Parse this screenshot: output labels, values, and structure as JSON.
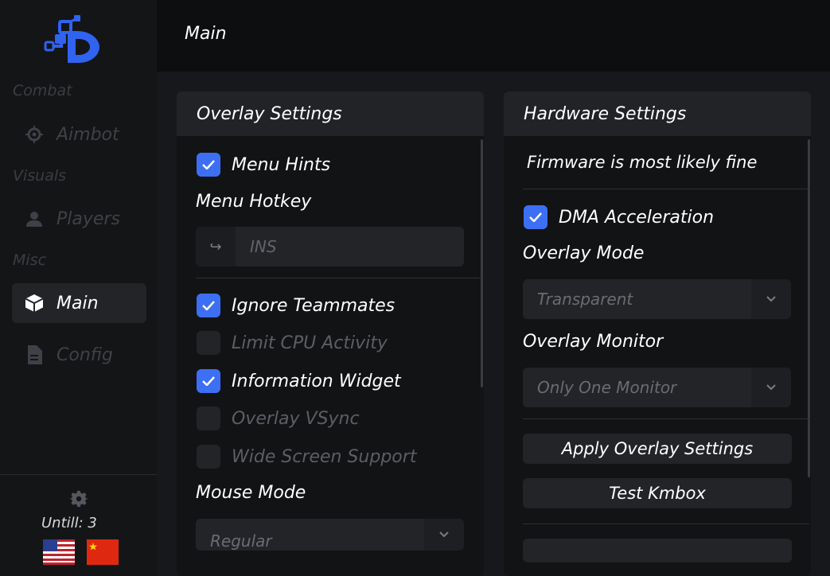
{
  "header": {
    "title": "Main"
  },
  "sidebar": {
    "sections": [
      {
        "label": "Combat",
        "items": [
          {
            "label": "Aimbot",
            "icon": "crosshair-icon",
            "active": false
          }
        ]
      },
      {
        "label": "Visuals",
        "items": [
          {
            "label": "Players",
            "icon": "user-icon",
            "active": false
          }
        ]
      },
      {
        "label": "Misc",
        "items": [
          {
            "label": "Main",
            "icon": "cube-icon",
            "active": true
          },
          {
            "label": "Config",
            "icon": "document-icon",
            "active": false
          }
        ]
      }
    ],
    "footer": {
      "until_text": "Untill: 3",
      "languages": [
        "us-flag",
        "cn-flag"
      ]
    }
  },
  "overlay_settings": {
    "title": "Overlay Settings",
    "menu_hints": {
      "label": "Menu Hints",
      "checked": true
    },
    "menu_hotkey": {
      "label": "Menu Hotkey",
      "prefix": "↪",
      "value": "INS"
    },
    "ignore_teammates": {
      "label": "Ignore Teammates",
      "checked": true
    },
    "limit_cpu": {
      "label": "Limit CPU Activity",
      "checked": false
    },
    "info_widget": {
      "label": "Information Widget",
      "checked": true
    },
    "vsync": {
      "label": "Overlay VSync",
      "checked": false
    },
    "wide_screen": {
      "label": "Wide Screen Support",
      "checked": false
    },
    "mouse_mode": {
      "label": "Mouse Mode",
      "value": "Regular"
    }
  },
  "hardware_settings": {
    "title": "Hardware Settings",
    "status": "Firmware is most likely fine",
    "dma_acceleration": {
      "label": "DMA Acceleration",
      "checked": true
    },
    "overlay_mode": {
      "label": "Overlay Mode",
      "value": "Transparent"
    },
    "overlay_monitor": {
      "label": "Overlay Monitor",
      "value": "Only One Monitor"
    },
    "apply_button": "Apply Overlay Settings",
    "test_button": "Test Kmbox"
  },
  "colors": {
    "accent": "#3d6ff5",
    "logo": "#2f63f0",
    "background": "#0d0e10"
  }
}
